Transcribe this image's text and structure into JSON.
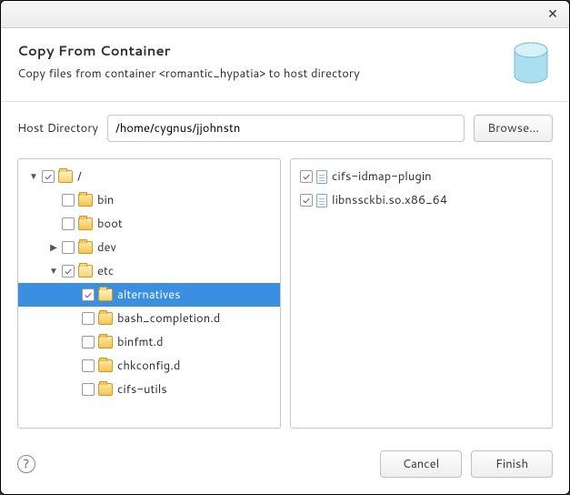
{
  "header": {
    "title": "Copy From Container",
    "subtitle": "Copy files from container <romantic_hypatia> to host directory"
  },
  "hostRow": {
    "label": "Host Directory",
    "value": "/home/cygnus/jjohnstn",
    "browse": "Browse..."
  },
  "tree": [
    {
      "depth": 0,
      "expander": "down",
      "checked": true,
      "open": true,
      "label": "/"
    },
    {
      "depth": 1,
      "expander": "none",
      "checked": false,
      "open": false,
      "label": "bin"
    },
    {
      "depth": 1,
      "expander": "none",
      "checked": false,
      "open": false,
      "label": "boot"
    },
    {
      "depth": 1,
      "expander": "right",
      "checked": false,
      "open": false,
      "label": "dev"
    },
    {
      "depth": 1,
      "expander": "down",
      "checked": true,
      "open": true,
      "label": "etc"
    },
    {
      "depth": 2,
      "expander": "none",
      "checked": true,
      "open": true,
      "label": "alternatives",
      "selected": true
    },
    {
      "depth": 2,
      "expander": "none",
      "checked": false,
      "open": false,
      "label": "bash_completion.d"
    },
    {
      "depth": 2,
      "expander": "none",
      "checked": false,
      "open": false,
      "label": "binfmt.d"
    },
    {
      "depth": 2,
      "expander": "none",
      "checked": false,
      "open": false,
      "label": "chkconfig.d"
    },
    {
      "depth": 2,
      "expander": "none",
      "checked": false,
      "open": false,
      "label": "cifs-utils"
    }
  ],
  "files": [
    {
      "checked": true,
      "label": "cifs-idmap-plugin"
    },
    {
      "checked": true,
      "label": "libnssckbi.so.x86_64"
    }
  ],
  "buttons": {
    "cancel": "Cancel",
    "finish": "Finish"
  }
}
